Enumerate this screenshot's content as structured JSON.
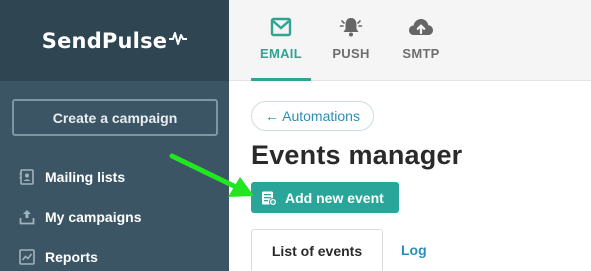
{
  "brand": {
    "name": "SendPulse",
    "logo_icon": "pulse-wave-icon"
  },
  "sidebar": {
    "create_button": "Create a campaign",
    "items": [
      {
        "label": "Mailing lists",
        "icon": "address-book-icon"
      },
      {
        "label": "My campaigns",
        "icon": "upload-icon"
      },
      {
        "label": "Reports",
        "icon": "chart-icon"
      }
    ]
  },
  "channels": {
    "tabs": [
      {
        "label": "EMAIL",
        "icon": "envelope-icon",
        "active": true
      },
      {
        "label": "PUSH",
        "icon": "bell-icon",
        "active": false
      },
      {
        "label": "SMTP",
        "icon": "cloud-upload-icon",
        "active": false
      }
    ]
  },
  "main": {
    "back_button": "← Automations",
    "title": "Events manager",
    "add_button": "Add new event",
    "sub_tabs": [
      {
        "label": "List of events",
        "active": true
      },
      {
        "label": "Log",
        "active": false
      }
    ]
  },
  "colors": {
    "sidebar_bg": "#3b5564",
    "brand_bg": "#2f4552",
    "accent_teal": "#2aa59a",
    "link_blue": "#2a8fb8",
    "annotation_green": "#22e622"
  }
}
